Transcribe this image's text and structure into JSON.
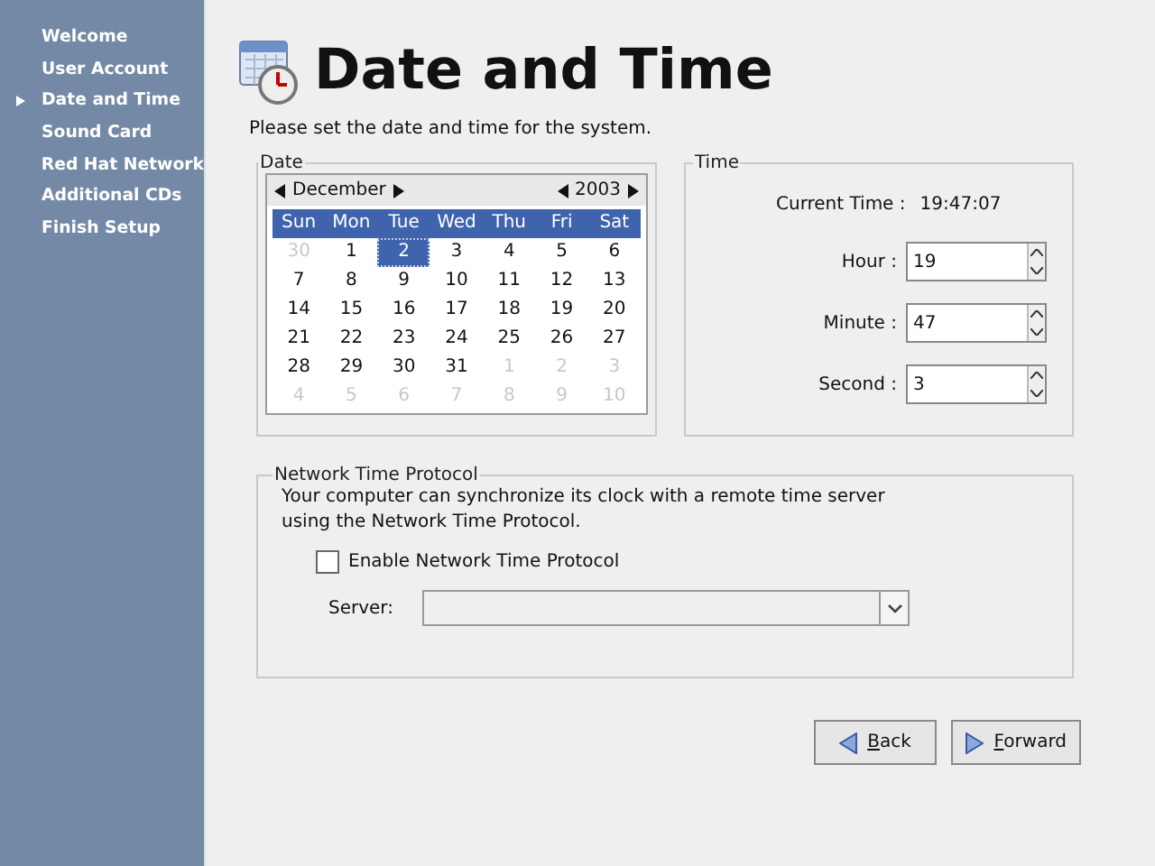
{
  "sidebar": {
    "items": [
      {
        "label": "Welcome",
        "selected": false
      },
      {
        "label": "User Account",
        "selected": false
      },
      {
        "label": "Date and Time",
        "selected": true
      },
      {
        "label": "Sound Card",
        "selected": false
      },
      {
        "label": "Red Hat Network",
        "selected": false
      },
      {
        "label": "Additional CDs",
        "selected": false
      },
      {
        "label": "Finish Setup",
        "selected": false
      }
    ]
  },
  "title": "Date and Time",
  "subtitle": "Please set the date and time for the system.",
  "date": {
    "legend": "Date",
    "month": "December",
    "year": "2003",
    "weekdays": [
      "Sun",
      "Mon",
      "Tue",
      "Wed",
      "Thu",
      "Fri",
      "Sat"
    ],
    "days": [
      {
        "day": "30",
        "in_month": false,
        "selected": false
      },
      {
        "day": "1",
        "in_month": true,
        "selected": false
      },
      {
        "day": "2",
        "in_month": true,
        "selected": true
      },
      {
        "day": "3",
        "in_month": true,
        "selected": false
      },
      {
        "day": "4",
        "in_month": true,
        "selected": false
      },
      {
        "day": "5",
        "in_month": true,
        "selected": false
      },
      {
        "day": "6",
        "in_month": true,
        "selected": false
      },
      {
        "day": "7",
        "in_month": true,
        "selected": false
      },
      {
        "day": "8",
        "in_month": true,
        "selected": false
      },
      {
        "day": "9",
        "in_month": true,
        "selected": false
      },
      {
        "day": "10",
        "in_month": true,
        "selected": false
      },
      {
        "day": "11",
        "in_month": true,
        "selected": false
      },
      {
        "day": "12",
        "in_month": true,
        "selected": false
      },
      {
        "day": "13",
        "in_month": true,
        "selected": false
      },
      {
        "day": "14",
        "in_month": true,
        "selected": false
      },
      {
        "day": "15",
        "in_month": true,
        "selected": false
      },
      {
        "day": "16",
        "in_month": true,
        "selected": false
      },
      {
        "day": "17",
        "in_month": true,
        "selected": false
      },
      {
        "day": "18",
        "in_month": true,
        "selected": false
      },
      {
        "day": "19",
        "in_month": true,
        "selected": false
      },
      {
        "day": "20",
        "in_month": true,
        "selected": false
      },
      {
        "day": "21",
        "in_month": true,
        "selected": false
      },
      {
        "day": "22",
        "in_month": true,
        "selected": false
      },
      {
        "day": "23",
        "in_month": true,
        "selected": false
      },
      {
        "day": "24",
        "in_month": true,
        "selected": false
      },
      {
        "day": "25",
        "in_month": true,
        "selected": false
      },
      {
        "day": "26",
        "in_month": true,
        "selected": false
      },
      {
        "day": "27",
        "in_month": true,
        "selected": false
      },
      {
        "day": "28",
        "in_month": true,
        "selected": false
      },
      {
        "day": "29",
        "in_month": true,
        "selected": false
      },
      {
        "day": "30",
        "in_month": true,
        "selected": false
      },
      {
        "day": "31",
        "in_month": true,
        "selected": false
      },
      {
        "day": "1",
        "in_month": false,
        "selected": false
      },
      {
        "day": "2",
        "in_month": false,
        "selected": false
      },
      {
        "day": "3",
        "in_month": false,
        "selected": false
      },
      {
        "day": "4",
        "in_month": false,
        "selected": false
      },
      {
        "day": "5",
        "in_month": false,
        "selected": false
      },
      {
        "day": "6",
        "in_month": false,
        "selected": false
      },
      {
        "day": "7",
        "in_month": false,
        "selected": false
      },
      {
        "day": "8",
        "in_month": false,
        "selected": false
      },
      {
        "day": "9",
        "in_month": false,
        "selected": false
      },
      {
        "day": "10",
        "in_month": false,
        "selected": false
      }
    ]
  },
  "time": {
    "legend": "Time",
    "current_label": "Current Time :",
    "current_value": "19:47:07",
    "fields": [
      {
        "label": "Hour :",
        "value": "19"
      },
      {
        "label": "Minute :",
        "value": "47"
      },
      {
        "label": "Second :",
        "value": "3"
      }
    ]
  },
  "ntp": {
    "legend": "Network Time Protocol",
    "description": "Your computer can synchronize its clock with a remote time server using the Network Time Protocol.",
    "enable": {
      "label": "Enable Network Time Protocol",
      "checked": false
    },
    "server_label": "Server:"
  },
  "buttons": [
    {
      "label": "Back",
      "kind": "back"
    },
    {
      "label": "Forward",
      "kind": "forward"
    }
  ]
}
